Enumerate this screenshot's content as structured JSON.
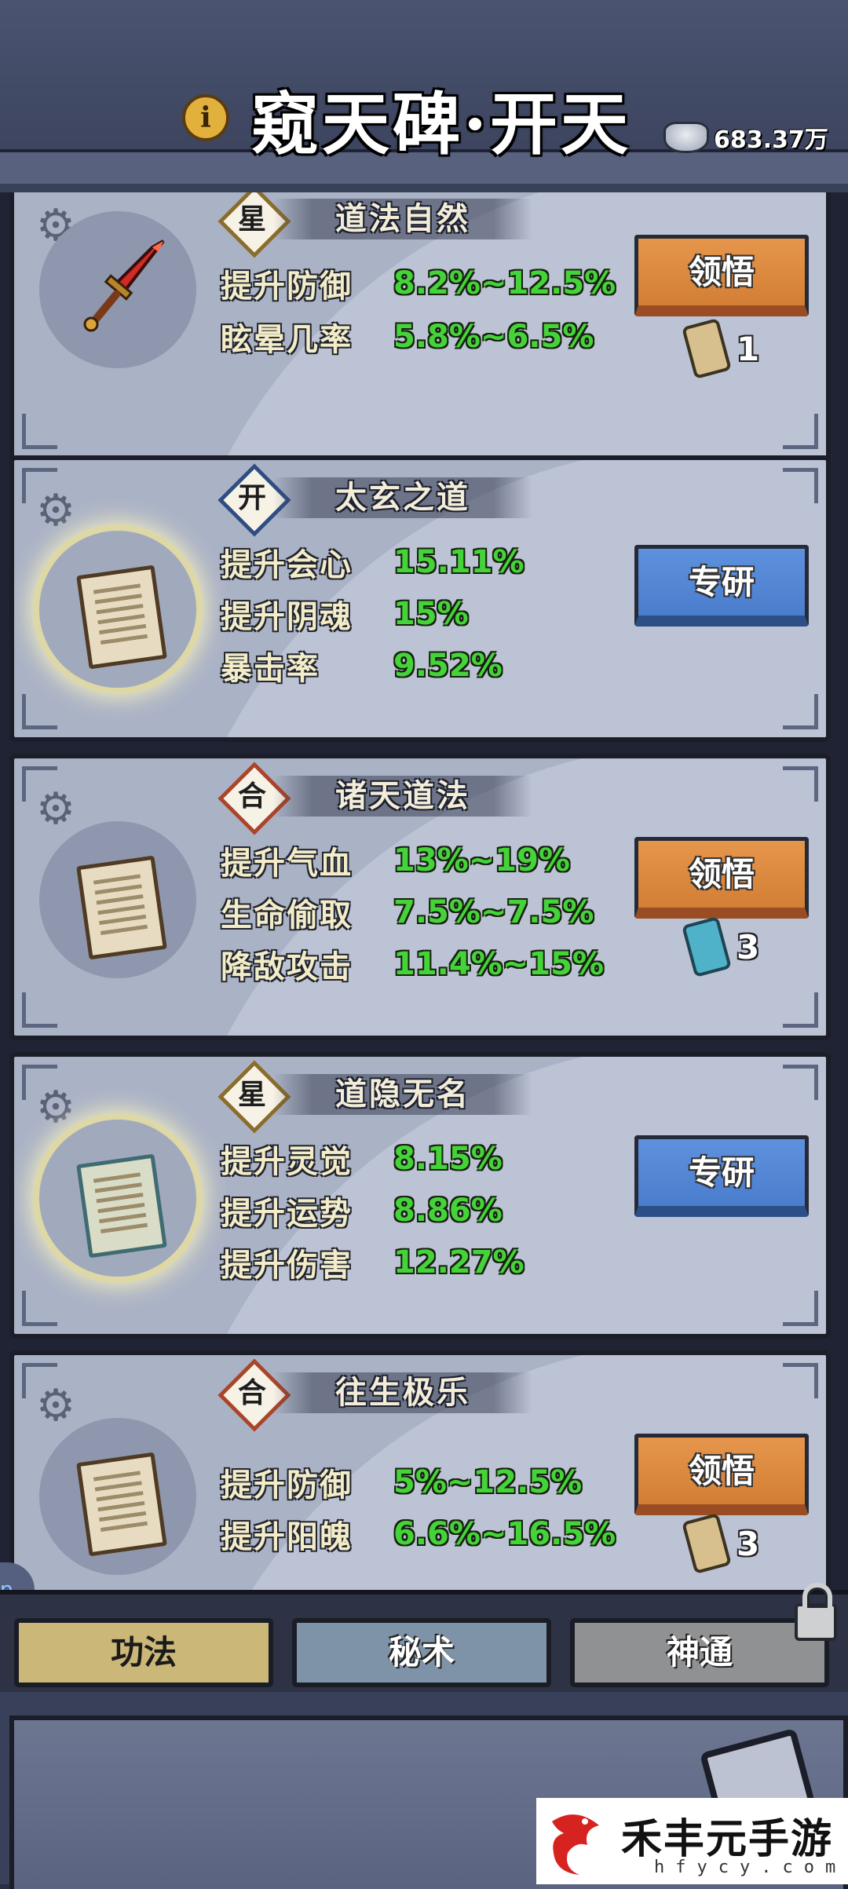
{
  "header": {
    "title": "窥天碑·开天",
    "info_glyph": "i",
    "currency_value": "683.37万"
  },
  "colors": {
    "orange_button": "#e6964c",
    "blue_button": "#5e91dd",
    "stat_value_green": "#45d33a",
    "badge_star": "#8a6d2c",
    "badge_kai": "#2f4d83",
    "badge_he": "#a8452a"
  },
  "cards": [
    {
      "badge": "星",
      "name": "道法自然",
      "icon": "red-sword-icon",
      "stats": [
        {
          "label": "提升防御",
          "value": "8.2%~12.5%"
        },
        {
          "label": "眩晕几率",
          "value": "5.8%~6.5%"
        }
      ],
      "action": "领悟",
      "cost": "1"
    },
    {
      "badge": "开",
      "name": "太玄之道",
      "icon": "scroll-icon",
      "stats": [
        {
          "label": "提升会心",
          "value": "15.11%"
        },
        {
          "label": "提升阴魂",
          "value": "15%"
        },
        {
          "label": "暴击率",
          "value": "9.52%"
        }
      ],
      "action": "专研",
      "cost": ""
    },
    {
      "badge": "合",
      "name": "诸天道法",
      "icon": "scroll-icon",
      "stats": [
        {
          "label": "提升气血",
          "value": "13%~19%"
        },
        {
          "label": "生命偷取",
          "value": "7.5%~7.5%"
        },
        {
          "label": "降敌攻击",
          "value": "11.4%~15%"
        }
      ],
      "action": "领悟",
      "cost": "3"
    },
    {
      "badge": "星",
      "name": "道隐无名",
      "icon": "scroll-icon",
      "stats": [
        {
          "label": "提升灵觉",
          "value": "8.15%"
        },
        {
          "label": "提升运势",
          "value": "8.86%"
        },
        {
          "label": "提升伤害",
          "value": "12.27%"
        }
      ],
      "action": "专研",
      "cost": ""
    },
    {
      "badge": "合",
      "name": "往生极乐",
      "icon": "scroll-icon",
      "stats": [
        {
          "label": "提升防御",
          "value": "5%~12.5%"
        },
        {
          "label": "提升阳魄",
          "value": "6.6%~16.5%"
        }
      ],
      "action": "领悟",
      "cost": "3"
    }
  ],
  "tabs": {
    "gongfa": "功法",
    "mishu": "秘术",
    "shentong": "神通"
  },
  "watermark": {
    "brand": "禾丰元手游",
    "domain": "hfycy.com"
  },
  "side_tag": "p"
}
